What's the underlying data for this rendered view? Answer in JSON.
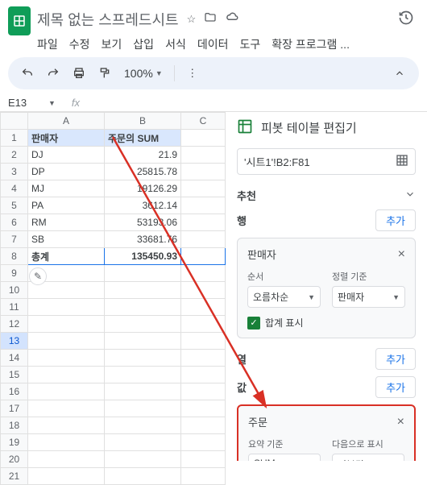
{
  "header": {
    "title": "제목 없는 스프레드시트",
    "menus": [
      "파일",
      "수정",
      "보기",
      "삽입",
      "서식",
      "데이터",
      "도구",
      "확장 프로그램 ..."
    ]
  },
  "toolbar": {
    "zoom": "100%"
  },
  "namebox": {
    "ref": "E13",
    "fx": "fx"
  },
  "sheet": {
    "cols": [
      "A",
      "B",
      "C"
    ],
    "headers": {
      "seller": "판매자",
      "sum": "주문의 SUM"
    },
    "rows": [
      {
        "seller": "DJ",
        "val": "21.9"
      },
      {
        "seller": "DP",
        "val": "25815.78"
      },
      {
        "seller": "MJ",
        "val": "19126.29"
      },
      {
        "seller": "PA",
        "val": "3612.14"
      },
      {
        "seller": "RM",
        "val": "53193.06"
      },
      {
        "seller": "SB",
        "val": "33681.76"
      }
    ],
    "total": {
      "label": "총계",
      "val": "135450.93"
    }
  },
  "panel": {
    "title": "피봇 테이블 편집기",
    "range": "'시트1'!B2:F81",
    "suggest": "추천",
    "row_label": "행",
    "col_label": "열",
    "val_label": "값",
    "add": "추가",
    "row_card": {
      "title": "판매자",
      "order_lbl": "순서",
      "order_val": "오름차순",
      "sort_lbl": "정렬 기준",
      "sort_val": "판매자",
      "show_total": "합계 표시"
    },
    "val_card": {
      "title": "주문",
      "sum_lbl": "요약 기준",
      "sum_val": "SUM",
      "show_lbl": "다음으로 표시",
      "show_val": "기본값"
    }
  }
}
